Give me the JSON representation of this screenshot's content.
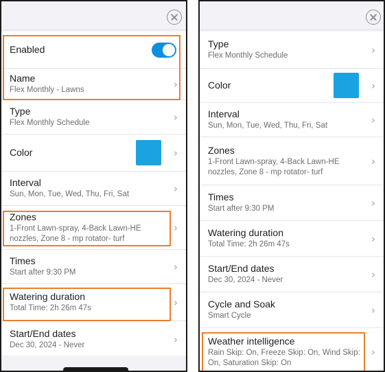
{
  "close_label": "Close",
  "left": {
    "enabled": {
      "label": "Enabled",
      "on": true,
      "accent": "#0d8fde"
    },
    "name": {
      "title": "Name",
      "value": "Flex Monthly - Lawns"
    },
    "type": {
      "title": "Type",
      "value": "Flex Monthly Schedule"
    },
    "color": {
      "title": "Color",
      "swatch": "#1aa3e0"
    },
    "interval": {
      "title": "Interval",
      "value": "Sun, Mon, Tue, Wed, Thu, Fri, Sat"
    },
    "zones": {
      "title": "Zones",
      "value": "1-Front Lawn-spray, 4-Back Lawn-HE nozzles, Zone 8 - mp rotator- turf"
    },
    "times": {
      "title": "Times",
      "value": "Start after 9:30 PM"
    },
    "watering": {
      "title": "Watering duration",
      "value": "Total Time: 2h 26m 47s"
    },
    "dates": {
      "title": "Start/End dates",
      "value": "Dec 30, 2024 - Never"
    }
  },
  "right": {
    "type": {
      "title": "Type",
      "value": "Flex Monthly Schedule"
    },
    "color": {
      "title": "Color",
      "swatch": "#1aa3e0"
    },
    "interval": {
      "title": "Interval",
      "value": "Sun, Mon, Tue, Wed, Thu, Fri, Sat"
    },
    "zones": {
      "title": "Zones",
      "value": "1-Front Lawn-spray, 4-Back Lawn-HE nozzles, Zone 8 - mp rotator- turf"
    },
    "times": {
      "title": "Times",
      "value": "Start after 9:30 PM"
    },
    "watering": {
      "title": "Watering duration",
      "value": "Total Time: 2h 26m 47s"
    },
    "dates": {
      "title": "Start/End dates",
      "value": "Dec 30, 2024 - Never"
    },
    "cycle": {
      "title": "Cycle and Soak",
      "value": "Smart Cycle"
    },
    "weather": {
      "title": "Weather intelligence",
      "value": "Rain Skip: On, Freeze Skip: On, Wind Skip: On, Saturation Skip: On"
    }
  },
  "highlight_color": "#ef7d2b",
  "chevron": "›"
}
